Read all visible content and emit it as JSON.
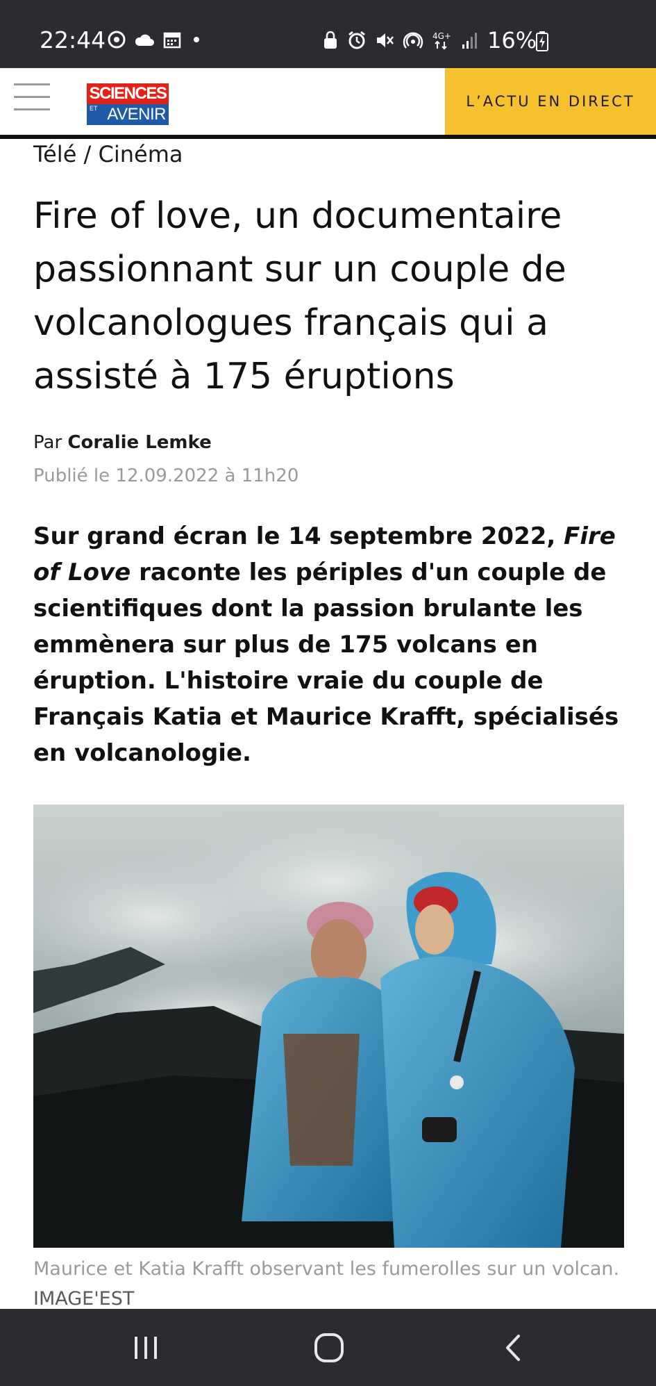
{
  "status_bar": {
    "time": "22:44",
    "battery": "16%",
    "left_icons": [
      "chrome-icon",
      "cloud-icon",
      "calendar-icon",
      "dot-icon"
    ],
    "right_icons": [
      "lock-icon",
      "alarm-icon",
      "mute-icon",
      "hotspot-icon",
      "4g-icon",
      "signal-icon",
      "battery-icon"
    ]
  },
  "header": {
    "logo_top": "SCIENCES",
    "logo_et": "ET",
    "logo_bottom": "AVENIR",
    "direct_label": "L’ACTU EN DIRECT",
    "direct_color": "#f6c02e"
  },
  "article": {
    "breadcrumb": "Télé / Cinéma",
    "title": "Fire of love, un documentaire passionnant sur un couple de volcanologues français qui a assisté à 175 éruptions",
    "byline_prefix": "Par",
    "author": "Coralie Lemke",
    "published": "Publié le 12.09.2022 à 11h20",
    "lede_part1": "Sur grand écran le 14 septembre 2022, ",
    "lede_italic": "Fire of Love",
    "lede_part2": " raconte les périples d'un couple de scientifiques dont la passion brulante les emmènera sur plus de 175 volcans en éruption. L'histoire vraie du couple de Français Katia et Maurice Krafft, spécialisés en volcanologie.",
    "image_caption": "Maurice et Katia Krafft observant les fumerolles sur un volcan.",
    "image_credit": "IMAGE'EST"
  },
  "nav_bar": {
    "buttons": [
      "recents-icon",
      "home-icon",
      "back-icon"
    ]
  }
}
